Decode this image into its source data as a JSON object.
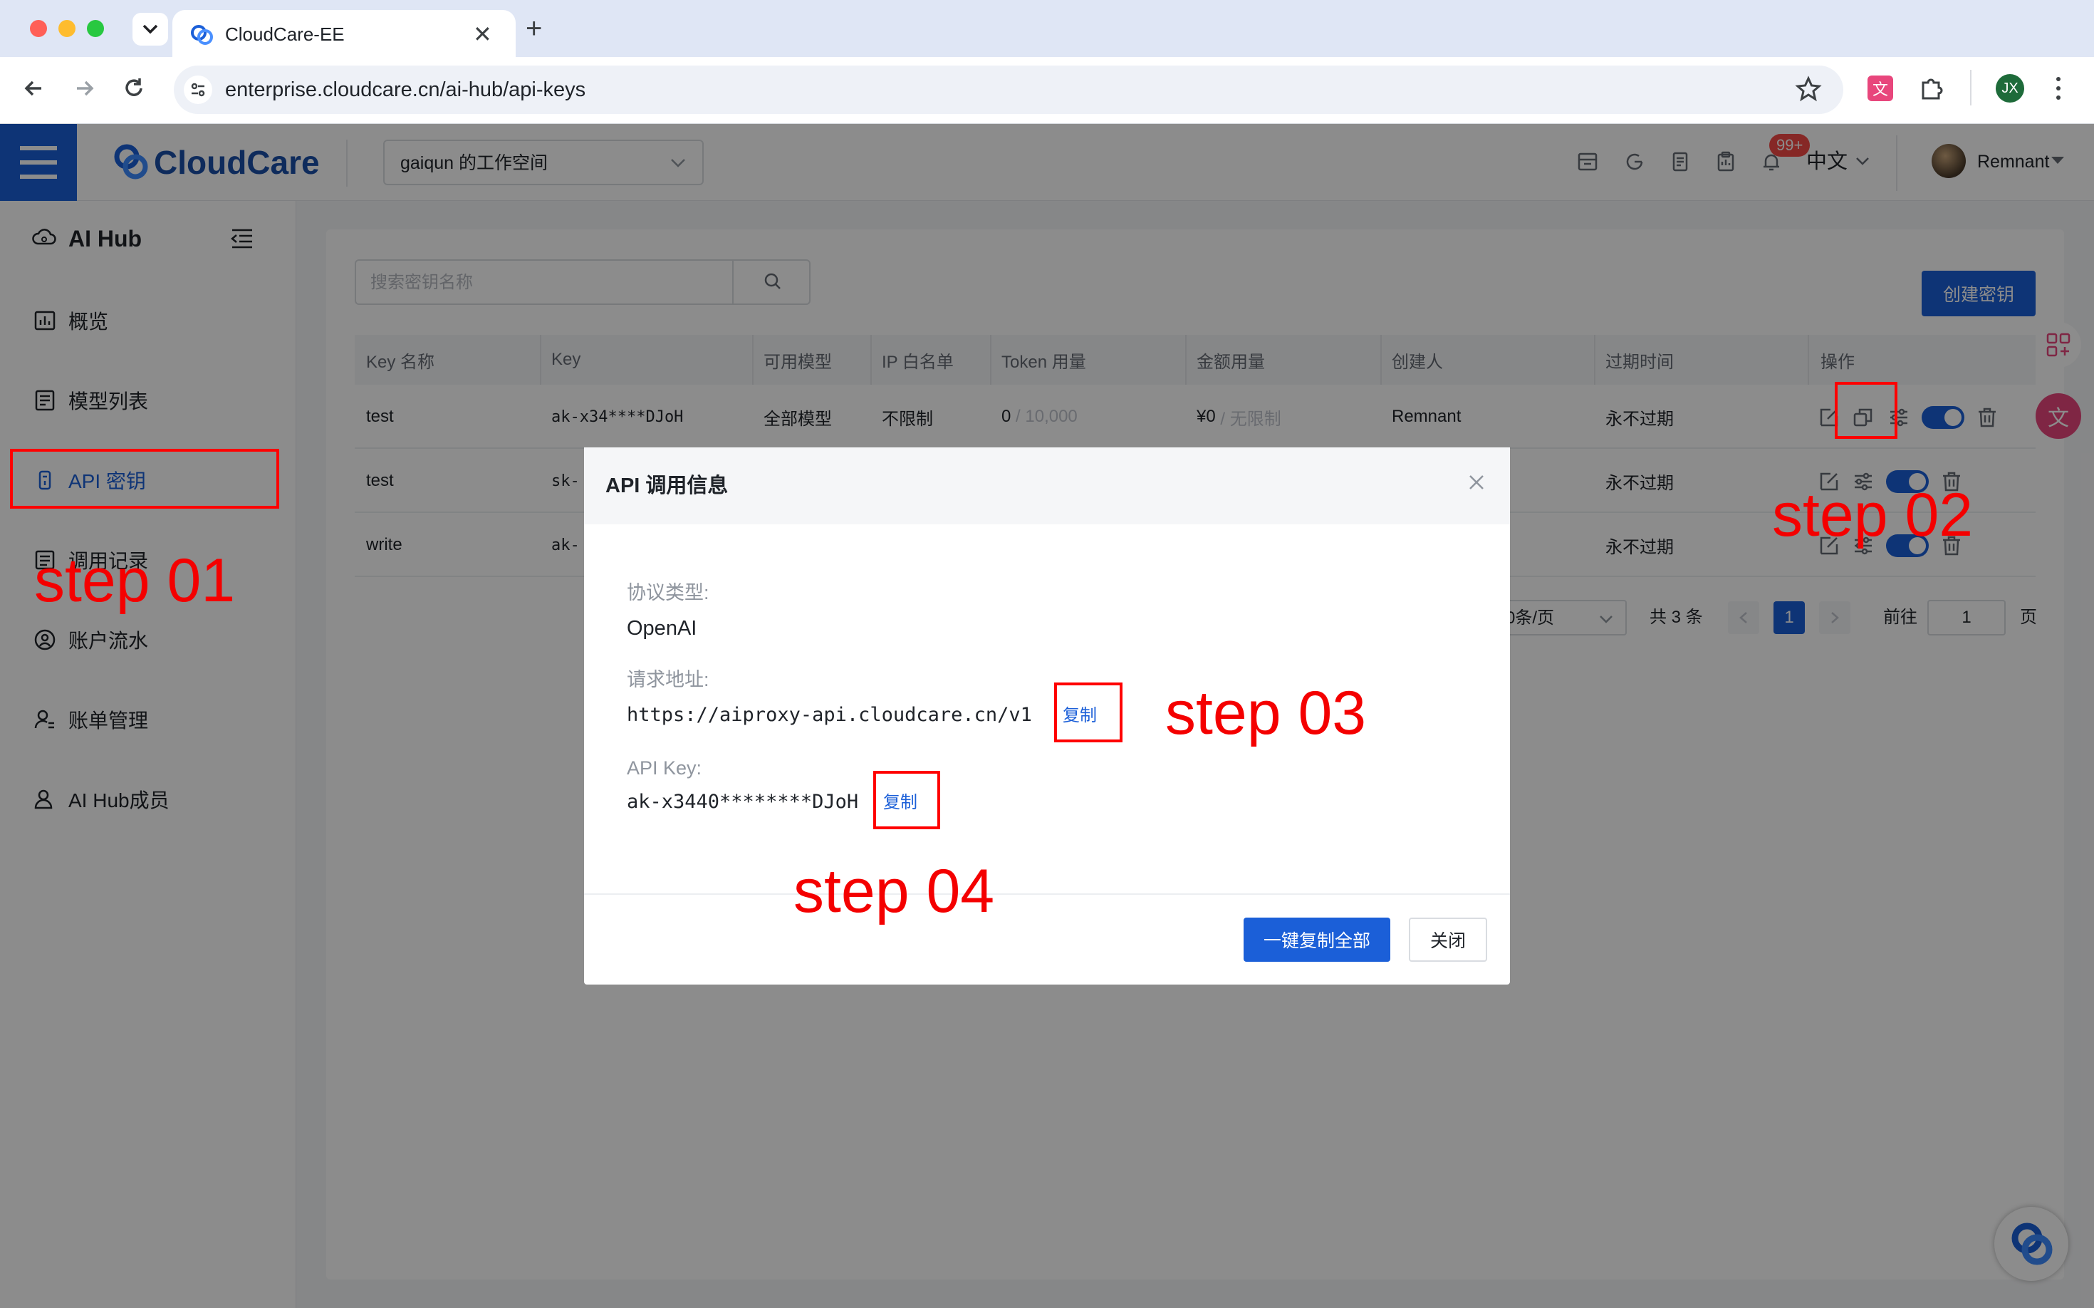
{
  "browser": {
    "tab_title": "CloudCare-EE",
    "url": "enterprise.cloudcare.cn/ai-hub/api-keys",
    "profile_initials": "JX"
  },
  "topnav": {
    "logo_text": "CloudCare",
    "workspace": "gaiqun 的工作空间",
    "notification_badge": "99+",
    "language": "中文",
    "username": "Remnant"
  },
  "sidebar": {
    "title": "AI Hub",
    "items": [
      {
        "label": "概览",
        "icon": "dashboard-icon"
      },
      {
        "label": "模型列表",
        "icon": "model-list-icon"
      },
      {
        "label": "API 密钥",
        "icon": "key-icon"
      },
      {
        "label": "调用记录",
        "icon": "records-icon"
      },
      {
        "label": "账户流水",
        "icon": "account-flow-icon"
      },
      {
        "label": "账单管理",
        "icon": "bill-icon"
      },
      {
        "label": "AI Hub成员",
        "icon": "members-icon"
      }
    ],
    "active_index": 2
  },
  "toolbar": {
    "search_placeholder": "搜索密钥名称",
    "create_label": "创建密钥"
  },
  "table": {
    "headers": [
      "Key 名称",
      "Key",
      "可用模型",
      "IP 白名单",
      "Token 用量",
      "金额用量",
      "创建人",
      "过期时间",
      "操作"
    ],
    "rows": [
      {
        "name": "test",
        "key": "ak-x34****DJoH",
        "models": "全部模型",
        "ip": "不限制",
        "token_used": "0",
        "token_limit": "/ 10,000",
        "amount": "¥0",
        "amount_limit": "/ 无限制",
        "creator": "Remnant",
        "expire": "永不过期",
        "enabled": true
      },
      {
        "name": "test",
        "key": "sk-",
        "models": "",
        "ip": "",
        "token_used": "",
        "token_limit": "",
        "amount": "",
        "amount_limit": "",
        "creator": "",
        "expire": "永不过期",
        "enabled": true
      },
      {
        "name": "write",
        "key": "ak-",
        "models": "",
        "ip": "",
        "token_used": "",
        "token_limit": "",
        "amount": "",
        "amount_limit": "",
        "creator": "",
        "expire": "永不过期",
        "enabled": true
      }
    ]
  },
  "pagination": {
    "page_size_partial": "0条/页",
    "total": "共 3 条",
    "current_page": "1",
    "goto_label": "前往",
    "goto_value": "1",
    "page_suffix": "页"
  },
  "modal": {
    "title": "API 调用信息",
    "protocol_label": "协议类型:",
    "protocol_value": "OpenAI",
    "endpoint_label": "请求地址:",
    "endpoint_value": "https://aiproxy-api.cloudcare.cn/v1",
    "apikey_label": "API Key:",
    "apikey_value": "ak-x3440********DJoH",
    "copy_label": "复制",
    "copy_all_label": "一键复制全部",
    "close_label": "关闭"
  },
  "annotations": {
    "step1": "step 01",
    "step2": "step 02",
    "step3": "step 03",
    "step4": "step 04",
    "color": "#ff0000"
  },
  "colors": {
    "primary": "#1b5fd8",
    "annotation": "#ff0000"
  }
}
